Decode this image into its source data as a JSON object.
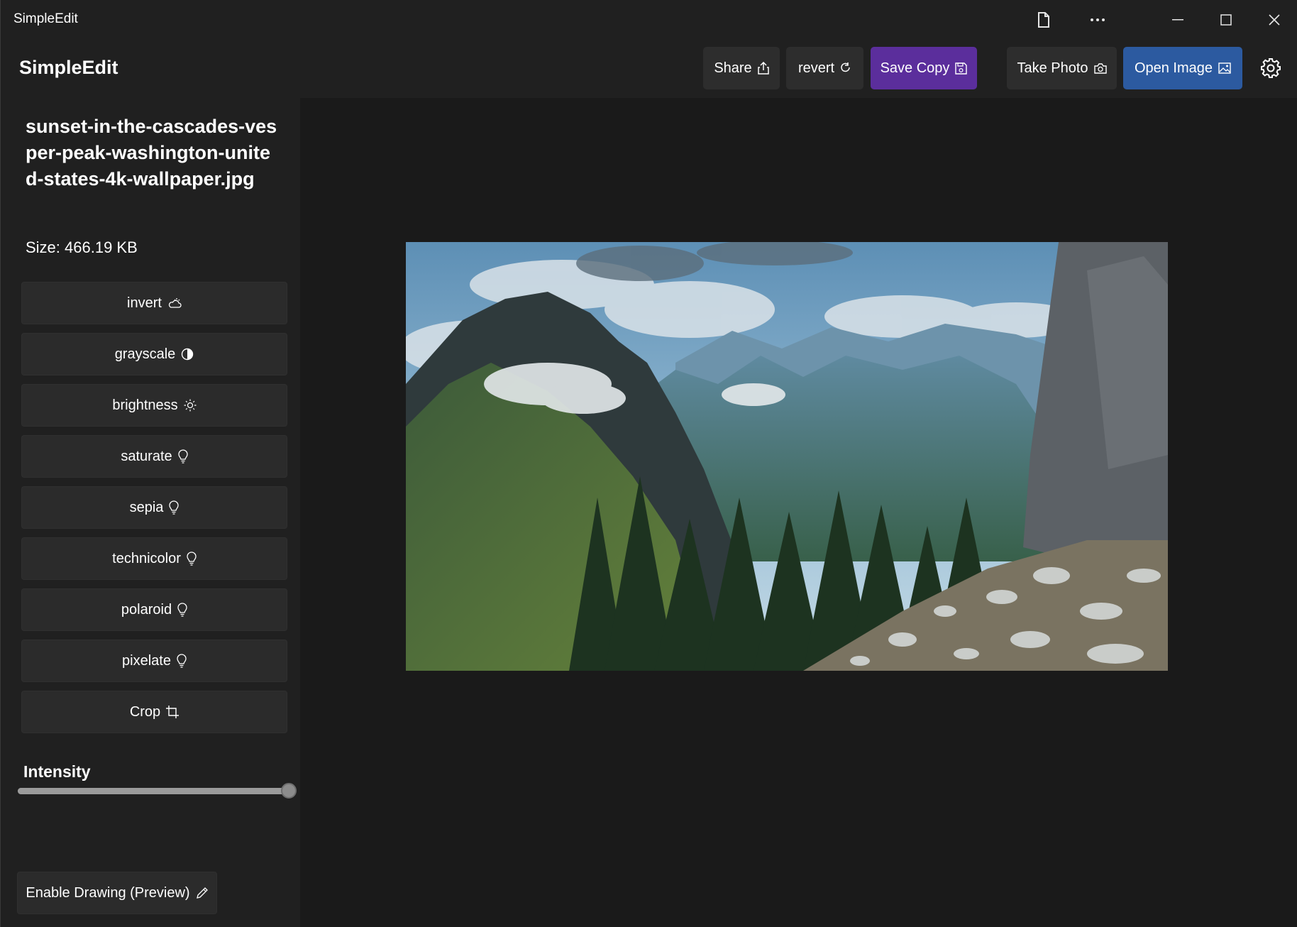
{
  "window": {
    "title": "SimpleEdit"
  },
  "header": {
    "app_name": "SimpleEdit",
    "share_label": "Share",
    "revert_label": "revert",
    "save_copy_label": "Save Copy",
    "take_photo_label": "Take Photo",
    "open_image_label": "Open Image",
    "save_copy_color": "#5b2e9c",
    "open_image_color": "#2c5aa0"
  },
  "file": {
    "name": "sunset-in-the-cascades-vesper-peak-washington-united-states-4k-wallpaper.jpg",
    "size": "Size: 466.19 KB"
  },
  "filters": [
    {
      "label": "invert",
      "icon": "cloud-sun-icon"
    },
    {
      "label": "grayscale",
      "icon": "contrast-icon"
    },
    {
      "label": "brightness",
      "icon": "sun-icon"
    },
    {
      "label": "saturate",
      "icon": "lightbulb-icon"
    },
    {
      "label": "sepia",
      "icon": "lightbulb-icon"
    },
    {
      "label": "technicolor",
      "icon": "lightbulb-icon"
    },
    {
      "label": "polaroid",
      "icon": "lightbulb-icon"
    },
    {
      "label": "pixelate",
      "icon": "lightbulb-icon"
    },
    {
      "label": "Crop",
      "icon": "crop-icon"
    }
  ],
  "intensity": {
    "label": "Intensity",
    "value": 1.0
  },
  "drawing": {
    "label": "Enable Drawing (Preview)",
    "icon": "pen-icon"
  },
  "image": {
    "alt": "Mountain landscape photo"
  }
}
